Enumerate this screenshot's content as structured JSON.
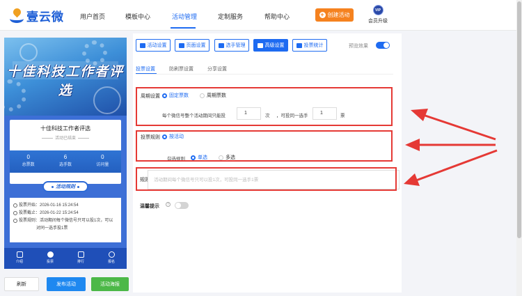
{
  "brand": {
    "name": "壹云微"
  },
  "nav": {
    "items": [
      {
        "label": "用户首页",
        "active": false
      },
      {
        "label": "模板中心",
        "active": false
      },
      {
        "label": "活动管理",
        "active": true
      },
      {
        "label": "定制服务",
        "active": false
      },
      {
        "label": "帮助中心",
        "active": false
      }
    ],
    "create_button": "创建活动",
    "vip_badge": "VIP",
    "vip_label": "会员升级"
  },
  "preview": {
    "banner_title": "十佳科技工作者评选",
    "activity_name": "十佳科技工作者评选",
    "status": "活动已结束",
    "stats": [
      {
        "value": "0",
        "label": "总票数"
      },
      {
        "value": "6",
        "label": "选手数"
      },
      {
        "value": "0",
        "label": "访问量"
      }
    ],
    "rules_pill": "活动规则",
    "rules": {
      "start": "投票开始：2026-01-16 15:24:54",
      "end": "投票截止：2026-01-22 15:24:54",
      "rule_line1": "投票规则：活动期间每个微信号只可以投1次，可以",
      "rule_line2": "对同一选手投1票"
    },
    "tabs": [
      "介绍",
      "投票",
      "排行",
      "报名"
    ]
  },
  "actions": {
    "refresh": "刷新",
    "publish": "发布活动",
    "poster": "活动海报"
  },
  "toolbar": {
    "buttons": [
      "活动设置",
      "页面设置",
      "选手管理",
      "高级设置",
      "投票统计"
    ],
    "active_index": 3,
    "preview_mode_label": "预览效果",
    "preview_mode_on": true
  },
  "subtabs": [
    "投票设置",
    "防刷票设置",
    "分享设置"
  ],
  "settings": {
    "cycle_label": "周期设置",
    "cycle_fixed": "固定票数",
    "cycle_periodic": "周期票数",
    "cycle_text1": "每个微信号整个活动期间只能投",
    "cycle_votes": "1",
    "cycle_text2": "次",
    "cycle_text3": "，可投同一选手",
    "cycle_same": "1",
    "cycle_text4": "票",
    "rule_label": "投票规则",
    "rule_option": "按活动",
    "select_label": "勾选规则",
    "single": "单选",
    "multi": "多选",
    "desc_label": "规则说明",
    "desc_placeholder": "活动期间每个微信号只可以投1次，可投同一选手1票",
    "tip_label": "温馨提示",
    "tip_on": false
  }
}
